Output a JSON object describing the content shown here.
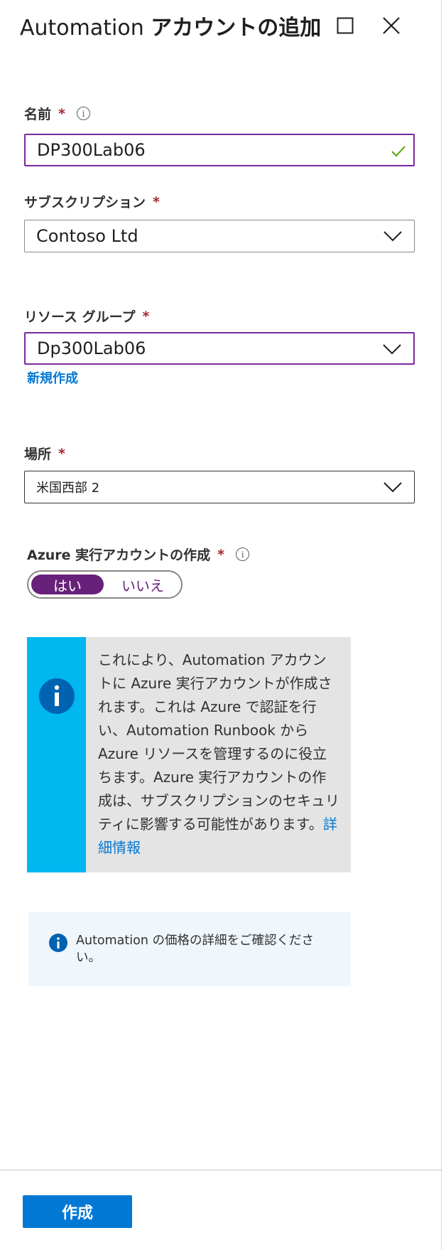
{
  "header": {
    "title_prefix": "Automation ",
    "title_suffix": "アカウントの追加",
    "maximize_icon": "maximize-icon",
    "close_icon": "close-icon"
  },
  "name_field": {
    "label": "名前",
    "required_mark": "*",
    "info_glyph": "i",
    "value": "DP300Lab06",
    "valid_icon": "checkmark-icon"
  },
  "subscription_field": {
    "label": "サブスクリプション",
    "required_mark": "*",
    "value": "Contoso Ltd"
  },
  "resource_group_field": {
    "label": "リソース グループ",
    "required_mark": "*",
    "value": "Dp300Lab06",
    "create_new_link": "新規作成"
  },
  "location_field": {
    "label": "場所",
    "required_mark": "*",
    "value": "米国西部 2"
  },
  "run_as_account": {
    "label": "Azure 実行アカウントの作成",
    "required_mark": "*",
    "info_glyph": "i",
    "options": [
      "はい",
      "いいえ"
    ],
    "selected": "はい"
  },
  "info_box": {
    "text": "これにより、Automation アカウントに Azure 実行アカウントが作成されます。これは Azure で認証を行い、Automation Runbook から Azure リソースを管理するのに役立ちます。Azure 実行アカウントの作成は、サブスクリプションのセキュリティに影響する可能性があります。",
    "link": "詳細情報",
    "icon": "info-icon"
  },
  "pricing_notice": {
    "text": "Automation の価格の詳細をご確認ください。",
    "icon": "info-icon"
  },
  "footer": {
    "create_button": "作成"
  },
  "colors": {
    "accent_purple": "#68217a",
    "focus_border": "#7a2a9c",
    "primary_blue": "#0078d4",
    "info_bar_cyan": "#00b7f0",
    "required_red": "#a4262c",
    "valid_green": "#57a300"
  }
}
